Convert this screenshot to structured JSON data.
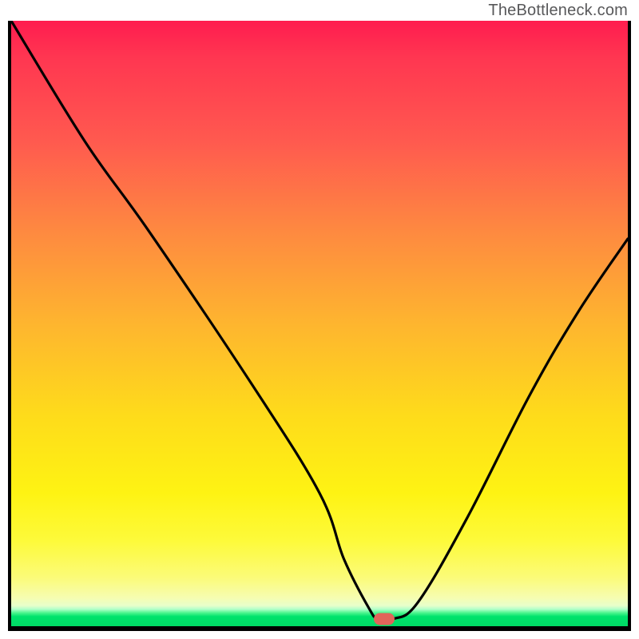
{
  "attribution": "TheBottleneck.com",
  "chart_data": {
    "type": "line",
    "title": "",
    "xlabel": "",
    "ylabel": "",
    "xlim": [
      0,
      100
    ],
    "ylim": [
      0,
      100
    ],
    "grid": false,
    "legend": false,
    "series": [
      {
        "name": "bottleneck-curve",
        "x": [
          0,
          12,
          22.5,
          39,
          50,
          54,
          58,
          59.5,
          62,
          66,
          74,
          84,
          92,
          100
        ],
        "values": [
          100,
          80,
          65,
          40,
          22,
          11,
          3,
          1.2,
          1.2,
          4,
          18,
          38,
          52,
          64
        ]
      }
    ],
    "marker": {
      "name": "optimal-point",
      "x": 60.5,
      "y": 1.2,
      "color": "#e1655a"
    },
    "background": {
      "type": "vertical-gradient",
      "stops": [
        {
          "pct": 0,
          "color": "#ff1c4f"
        },
        {
          "pct": 50,
          "color": "#feb52f"
        },
        {
          "pct": 78,
          "color": "#fef313"
        },
        {
          "pct": 96.5,
          "color": "#f6fdb1"
        },
        {
          "pct": 98,
          "color": "#4bf58d"
        },
        {
          "pct": 100,
          "color": "#00db65"
        }
      ]
    }
  }
}
